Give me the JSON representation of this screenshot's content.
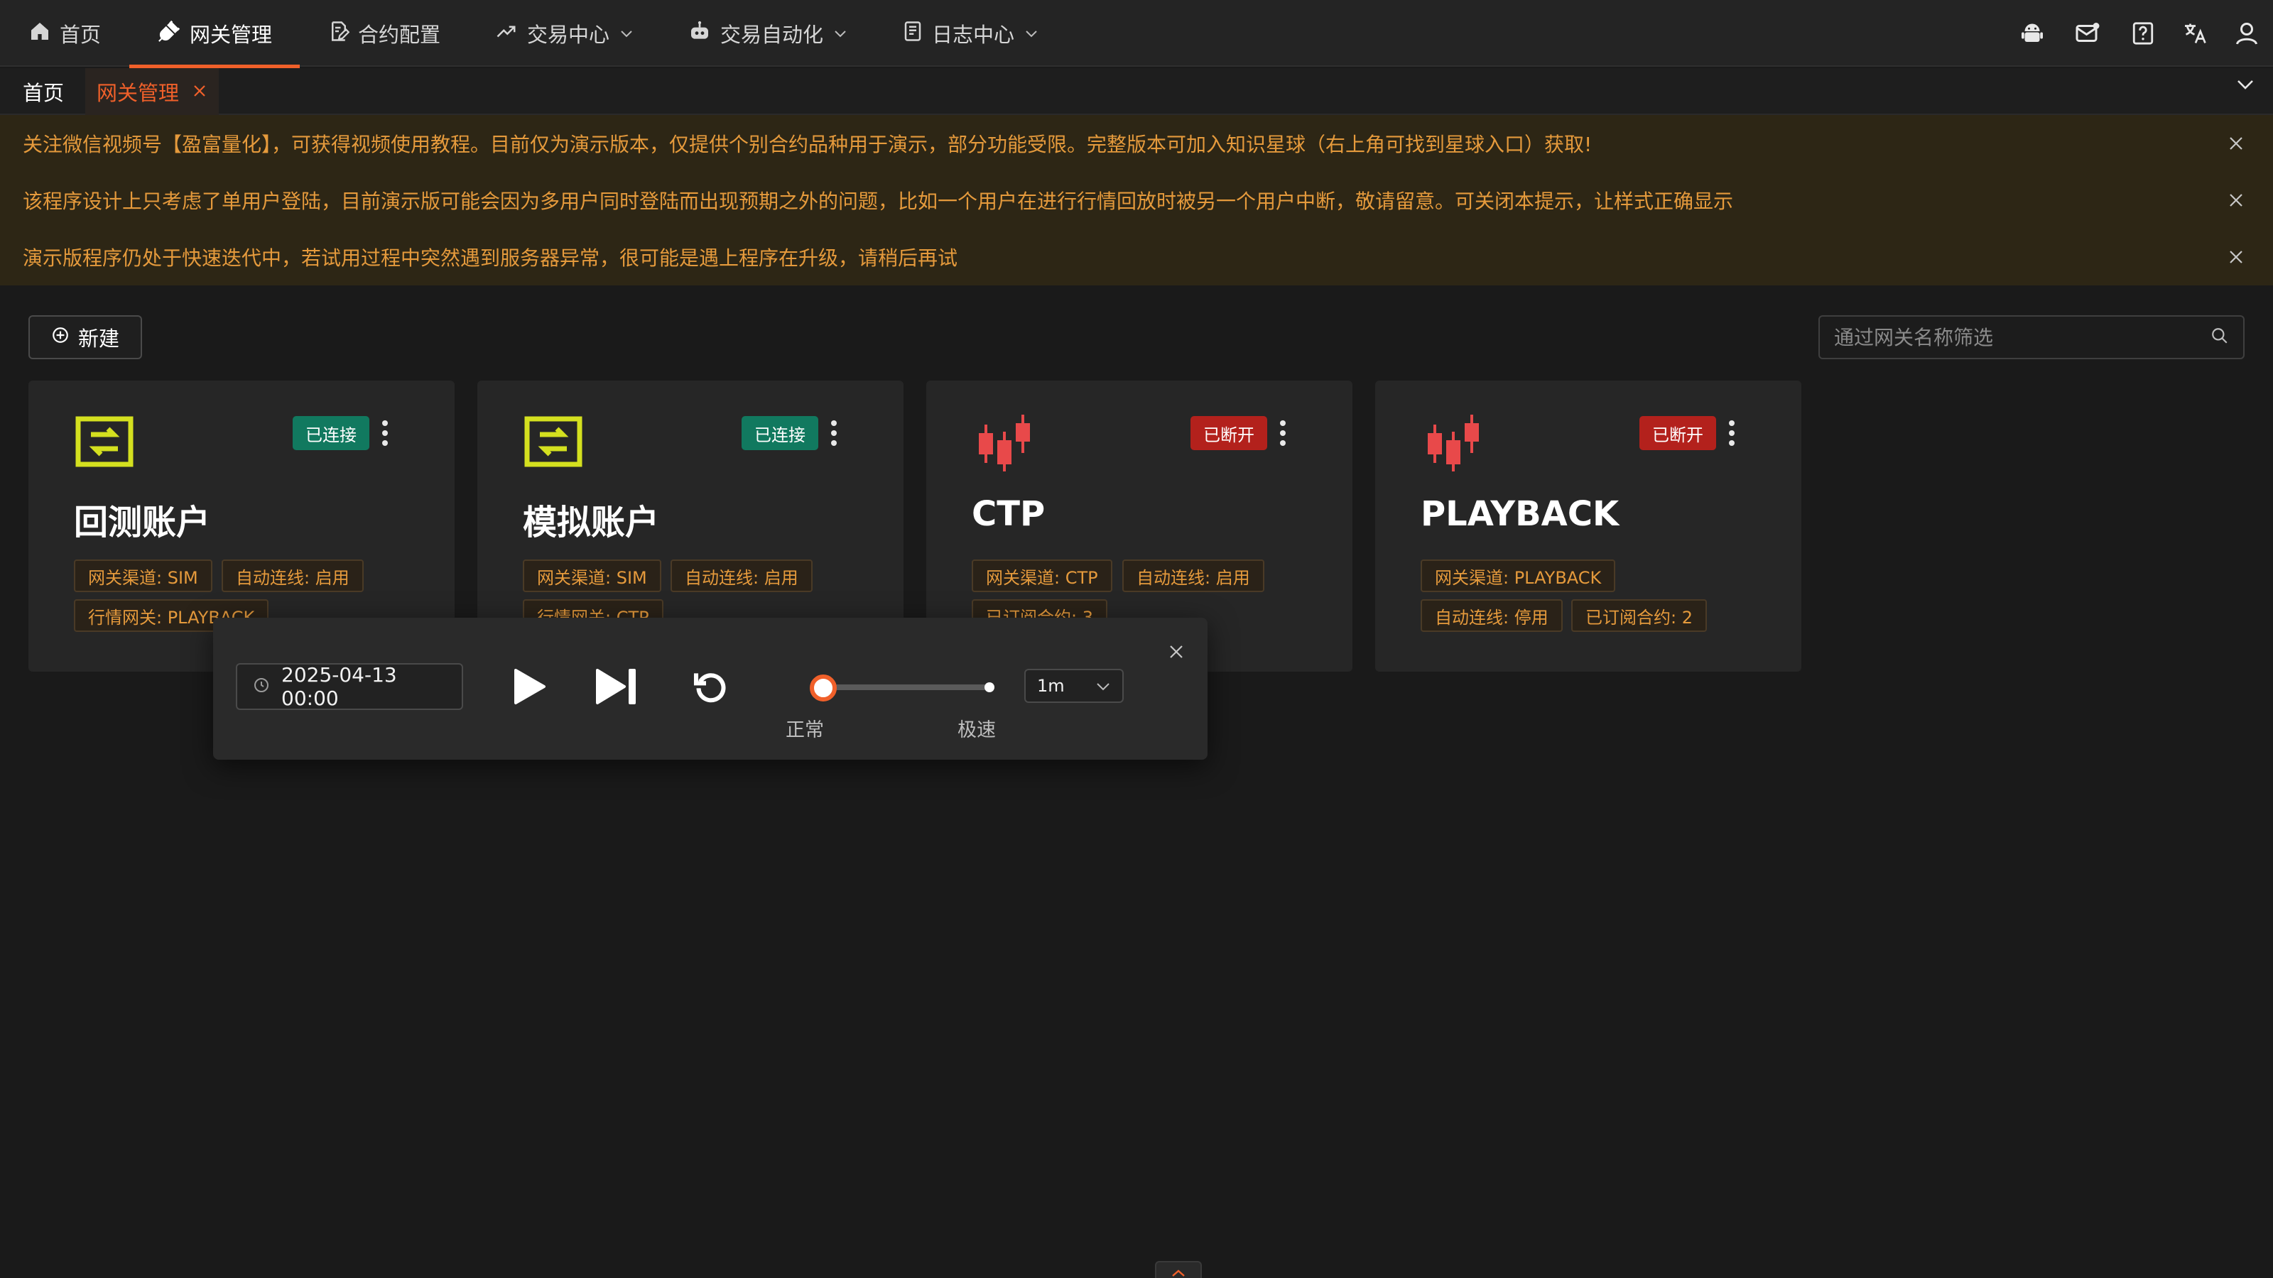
{
  "nav": {
    "items": [
      {
        "label": "首页",
        "icon": "home-icon"
      },
      {
        "label": "网关管理",
        "icon": "plug-icon",
        "active": true
      },
      {
        "label": "合约配置",
        "icon": "contract-edit-icon"
      },
      {
        "label": "交易中心",
        "icon": "trend-up-icon",
        "dropdown": true
      },
      {
        "label": "交易自动化",
        "icon": "robot-icon",
        "dropdown": true
      },
      {
        "label": "日志中心",
        "icon": "log-icon",
        "dropdown": true
      }
    ],
    "right_icons": [
      "android-icon",
      "mail-icon",
      "help-icon",
      "translate-icon",
      "user-icon"
    ],
    "accent_color": "#f0602a"
  },
  "tabs": {
    "home_label": "首页",
    "active_label": "网关管理"
  },
  "notices": [
    "关注微信视频号【盈富量化】，可获得视频使用教程。目前仅为演示版本，仅提供个别合约品种用于演示，部分功能受限。完整版本可加入知识星球（右上角可找到星球入口）获取!",
    "该程序设计上只考虑了单用户登陆，目前演示版可能会因为多用户同时登陆而出现预期之外的问题，比如一个用户在进行行情回放时被另一个用户中断，敬请留意。可关闭本提示，让样式正确显示",
    "演示版程序仍处于快速迭代中，若试用过程中突然遇到服务器异常，很可能是遇上程序在升级，请稍后再试"
  ],
  "toolbar": {
    "new_label": "新建",
    "search_placeholder": "通过网关名称筛选"
  },
  "cards": [
    {
      "name": "回测账户",
      "status": "已连接",
      "status_kind": "ok",
      "icon": "exchange-icon",
      "tags": [
        "网关渠道: SIM",
        "自动连线: 启用",
        "行情网关: PLAYBACK"
      ]
    },
    {
      "name": "模拟账户",
      "status": "已连接",
      "status_kind": "ok",
      "icon": "exchange-icon",
      "tags": [
        "网关渠道: SIM",
        "自动连线: 启用",
        "行情网关: CTP"
      ]
    },
    {
      "name": "CTP",
      "status": "已断开",
      "status_kind": "off",
      "icon": "candlestick-icon",
      "tags": [
        "网关渠道: CTP",
        "自动连线: 启用",
        "已订阅合约: 3"
      ]
    },
    {
      "name": "PLAYBACK",
      "status": "已断开",
      "status_kind": "off",
      "icon": "candlestick-icon",
      "tags": [
        "网关渠道: PLAYBACK",
        "自动连线: 停用",
        "已订阅合约: 2"
      ]
    }
  ],
  "playback": {
    "datetime": "2025-04-13 00:00",
    "speed_label_min": "正常",
    "speed_label_max": "极速",
    "speed_level": 0,
    "interval": "1m"
  },
  "colors": {
    "status_ok": "#11795f",
    "status_off": "#b3211c",
    "tag_text": "#e59a3c",
    "notice_bg": "#2d2615",
    "icon_yellow": "#d4e01f",
    "icon_red": "#e8494a"
  }
}
